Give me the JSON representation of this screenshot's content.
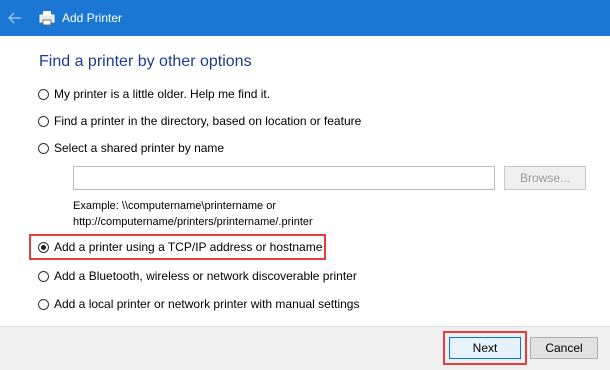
{
  "window": {
    "title": "Add Printer"
  },
  "heading": "Find a printer by other options",
  "options": [
    {
      "label": "My printer is a little older. Help me find it.",
      "checked": false
    },
    {
      "label": "Find a printer in the directory, based on location or feature",
      "checked": false
    },
    {
      "label": "Select a shared printer by name",
      "checked": false
    },
    {
      "label": "Add a printer using a TCP/IP address or hostname",
      "checked": true
    },
    {
      "label": "Add a Bluetooth, wireless or network discoverable printer",
      "checked": false
    },
    {
      "label": "Add a local printer or network printer with manual settings",
      "checked": false
    }
  ],
  "shared_printer": {
    "value": "",
    "browse_label": "Browse...",
    "example_line1": "Example: \\\\computername\\printername or",
    "example_line2": "http://computername/printers/printername/.printer"
  },
  "buttons": {
    "next": "Next",
    "cancel": "Cancel"
  },
  "colors": {
    "titlebar": "#1a78d4",
    "heading": "#1e3c8c",
    "highlight": "#e63d3d"
  },
  "icons": {
    "back": "back-arrow-icon",
    "printer": "printer-icon"
  }
}
